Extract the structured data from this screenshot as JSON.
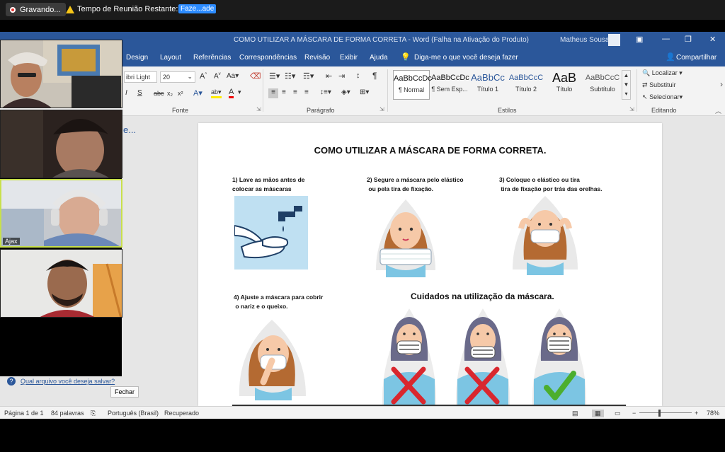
{
  "zoom": {
    "recording_label": "Gravando...",
    "timer_text": "Tempo de Reunião Restante: 09:20",
    "upgrade_label": "Faze...ade",
    "participant_name": "Ajax"
  },
  "word": {
    "title": "COMO UTILIZAR A MÁSCARA DE FORMA CORRETA  -  Word (Falha na Ativação do Produto)",
    "user": "Matheus Sousa",
    "menu": [
      "Design",
      "Layout",
      "Referências",
      "Correspondências",
      "Revisão",
      "Exibir",
      "Ajuda"
    ],
    "tell_me": "Diga-me o que você deseja fazer",
    "share": "Compartilhar",
    "font_name": "ibri Light",
    "font_size": "20",
    "groups": {
      "font": "Fonte",
      "paragraph": "Parágrafo",
      "styles": "Estilos",
      "editing": "Editando"
    },
    "styles": [
      {
        "sample": "AaBbCcDc",
        "name": "¶ Normal"
      },
      {
        "sample": "AaBbCcDc",
        "name": "¶ Sem Esp..."
      },
      {
        "sample": "AaBbCc",
        "name": "Título 1"
      },
      {
        "sample": "AaBbCcC",
        "name": "Título 2"
      },
      {
        "sample": "AaB",
        "name": "Título"
      },
      {
        "sample": "AaBbCcC",
        "name": "Subtítulo"
      }
    ],
    "editing": [
      "Localizar",
      "Substituir",
      "Selecionar"
    ],
    "nav_fragment": "e...",
    "help_link": "Qual arquivo você deseja salvar?",
    "close_button": "Fechar",
    "status": {
      "page": "Página 1 de 1",
      "words": "84 palavras",
      "language": "Português (Brasil)",
      "recovered": "Recuperado",
      "zoom": "78%"
    }
  },
  "document": {
    "title": "COMO UTILIZAR A MÁSCARA DE FORMA CORRETA.",
    "step1_a": "1) Lave as mãos antes de",
    "step1_b": "colocar as máscaras",
    "step2_a": "2) Segure a máscara pelo elástico",
    "step2_b": "ou pela tira de fixação.",
    "step3_a": "3) Coloque o elástico ou tira",
    "step3_b": "tira de fixação por trás das orelhas.",
    "step4_a": "4) Ajuste a máscara para cobrir",
    "step4_b": "o nariz e o queixo.",
    "care_heading": "Cuidados na utilização da máscara."
  },
  "colors": {
    "word_blue": "#2b579a",
    "wrong": "#d9272e",
    "right": "#4cae2e",
    "zoom_blue": "#2d8cff"
  }
}
